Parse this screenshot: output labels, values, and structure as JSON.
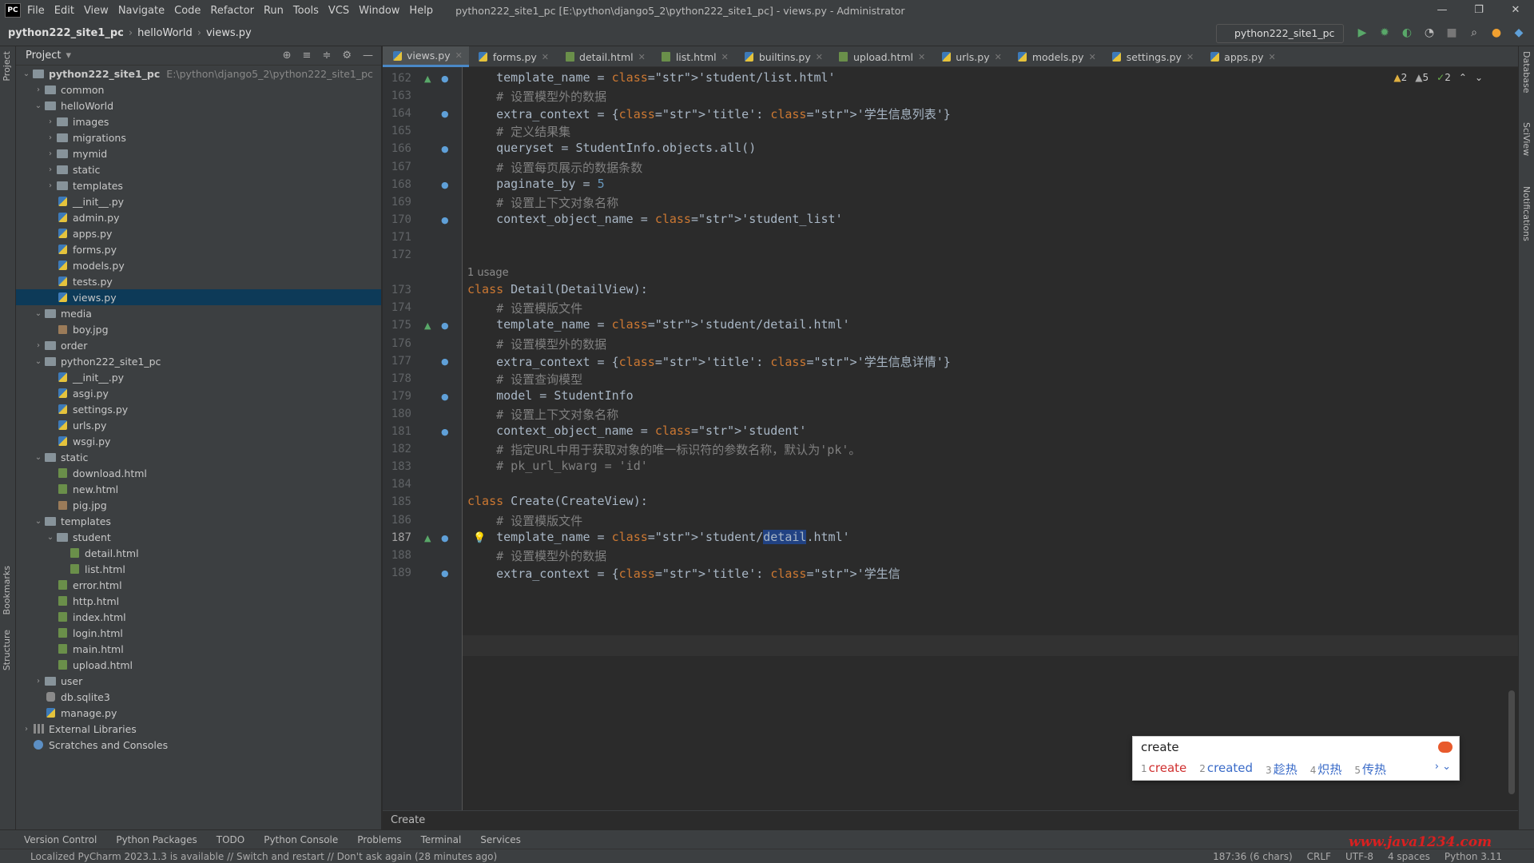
{
  "app": {
    "logo": "PC",
    "window_title": "python222_site1_pc [E:\\python\\django5_2\\python222_site1_pc] - views.py - Administrator",
    "menu": [
      "File",
      "Edit",
      "View",
      "Navigate",
      "Code",
      "Refactor",
      "Run",
      "Tools",
      "VCS",
      "Window",
      "Help"
    ],
    "window_controls": [
      "—",
      "❐",
      "✕"
    ]
  },
  "navbar": {
    "breadcrumb": [
      "python222_site1_pc",
      "helloWorld",
      "views.py"
    ],
    "run_config": "python222_site1_pc"
  },
  "side_strips": {
    "left": [
      "Project",
      "Bookmarks",
      "Structure"
    ],
    "right": [
      "Database",
      "SciView",
      "Notifications"
    ]
  },
  "project_panel": {
    "title": "Project",
    "root_path": "E:\\python\\django5_2\\python222_site1_pc",
    "tree": [
      {
        "label": "python222_site1_pc",
        "type": "folder",
        "open": true,
        "bold": true
      },
      {
        "label": "common",
        "type": "folder",
        "open": false
      },
      {
        "label": "helloWorld",
        "type": "folder",
        "open": true
      },
      {
        "label": "images",
        "type": "folder",
        "open": false
      },
      {
        "label": "migrations",
        "type": "folder",
        "open": false
      },
      {
        "label": "mymid",
        "type": "folder",
        "open": false
      },
      {
        "label": "static",
        "type": "folder",
        "open": false
      },
      {
        "label": "templates",
        "type": "folder",
        "open": false
      },
      {
        "label": "__init__.py",
        "type": "py"
      },
      {
        "label": "admin.py",
        "type": "py"
      },
      {
        "label": "apps.py",
        "type": "py"
      },
      {
        "label": "forms.py",
        "type": "py"
      },
      {
        "label": "models.py",
        "type": "py"
      },
      {
        "label": "tests.py",
        "type": "py"
      },
      {
        "label": "views.py",
        "type": "py",
        "selected": true
      },
      {
        "label": "media",
        "type": "folder",
        "open": true
      },
      {
        "label": "boy.jpg",
        "type": "img"
      },
      {
        "label": "order",
        "type": "folder",
        "open": false
      },
      {
        "label": "python222_site1_pc",
        "type": "folder",
        "open": true
      },
      {
        "label": "__init__.py",
        "type": "py"
      },
      {
        "label": "asgi.py",
        "type": "py"
      },
      {
        "label": "settings.py",
        "type": "py"
      },
      {
        "label": "urls.py",
        "type": "py"
      },
      {
        "label": "wsgi.py",
        "type": "py"
      },
      {
        "label": "static",
        "type": "folder",
        "open": true
      },
      {
        "label": "download.html",
        "type": "html"
      },
      {
        "label": "new.html",
        "type": "html"
      },
      {
        "label": "pig.jpg",
        "type": "img"
      },
      {
        "label": "templates",
        "type": "folder",
        "open": true
      },
      {
        "label": "student",
        "type": "folder",
        "open": true
      },
      {
        "label": "detail.html",
        "type": "html"
      },
      {
        "label": "list.html",
        "type": "html"
      },
      {
        "label": "error.html",
        "type": "html"
      },
      {
        "label": "http.html",
        "type": "html"
      },
      {
        "label": "index.html",
        "type": "html"
      },
      {
        "label": "login.html",
        "type": "html"
      },
      {
        "label": "main.html",
        "type": "html"
      },
      {
        "label": "upload.html",
        "type": "html"
      },
      {
        "label": "user",
        "type": "folder",
        "open": false
      },
      {
        "label": "db.sqlite3",
        "type": "db"
      },
      {
        "label": "manage.py",
        "type": "py"
      },
      {
        "label": "External Libraries",
        "type": "lib",
        "open": false
      },
      {
        "label": "Scratches and Consoles",
        "type": "scratch"
      }
    ]
  },
  "tabs": [
    {
      "label": "views.py",
      "type": "py",
      "active": true
    },
    {
      "label": "forms.py",
      "type": "py"
    },
    {
      "label": "detail.html",
      "type": "html"
    },
    {
      "label": "list.html",
      "type": "html"
    },
    {
      "label": "builtins.py",
      "type": "py"
    },
    {
      "label": "upload.html",
      "type": "html"
    },
    {
      "label": "urls.py",
      "type": "py"
    },
    {
      "label": "models.py",
      "type": "py"
    },
    {
      "label": "settings.py",
      "type": "py"
    },
    {
      "label": "apps.py",
      "type": "py"
    }
  ],
  "inspections": {
    "warn1": "2",
    "warn2": "5",
    "ok": "2"
  },
  "code": {
    "usage_hint": "1 usage",
    "lines": [
      {
        "n": "162",
        "text": "    template_name = 'student/list.html'"
      },
      {
        "n": "163",
        "text": "    # 设置模型外的数据"
      },
      {
        "n": "164",
        "text": "    extra_context = {'title': '学生信息列表'}"
      },
      {
        "n": "165",
        "text": "    # 定义结果集"
      },
      {
        "n": "166",
        "text": "    queryset = StudentInfo.objects.all()"
      },
      {
        "n": "167",
        "text": "    # 设置每页展示的数据条数"
      },
      {
        "n": "168",
        "text": "    paginate_by = 5"
      },
      {
        "n": "169",
        "text": "    # 设置上下文对象名称"
      },
      {
        "n": "170",
        "text": "    context_object_name = 'student_list'"
      },
      {
        "n": "171",
        "text": ""
      },
      {
        "n": "172",
        "text": ""
      },
      {
        "n": "173",
        "text": "class Detail(DetailView):"
      },
      {
        "n": "174",
        "text": "    # 设置模版文件"
      },
      {
        "n": "175",
        "text": "    template_name = 'student/detail.html'"
      },
      {
        "n": "176",
        "text": "    # 设置模型外的数据"
      },
      {
        "n": "177",
        "text": "    extra_context = {'title': '学生信息详情'}"
      },
      {
        "n": "178",
        "text": "    # 设置查询模型"
      },
      {
        "n": "179",
        "text": "    model = StudentInfo"
      },
      {
        "n": "180",
        "text": "    # 设置上下文对象名称"
      },
      {
        "n": "181",
        "text": "    context_object_name = 'student'"
      },
      {
        "n": "182",
        "text": "    # 指定URL中用于获取对象的唯一标识符的参数名称，默认为'pk'。"
      },
      {
        "n": "183",
        "text": "    # pk_url_kwarg = 'id'"
      },
      {
        "n": "184",
        "text": ""
      },
      {
        "n": "185",
        "text": "class Create(CreateView):"
      },
      {
        "n": "186",
        "text": "    # 设置模版文件"
      },
      {
        "n": "187",
        "text": "    template_name = 'student/detail.html'"
      },
      {
        "n": "188",
        "text": "    # 设置模型外的数据"
      },
      {
        "n": "189",
        "text": "    extra_context = {'title': '学生信"
      }
    ]
  },
  "ime": {
    "input": "create",
    "candidates": [
      {
        "num": "1",
        "text": "create"
      },
      {
        "num": "2",
        "text": "created"
      },
      {
        "num": "3",
        "text": "趁热"
      },
      {
        "num": "4",
        "text": "炽热"
      },
      {
        "num": "5",
        "text": "传热"
      }
    ],
    "more": "› ⌄"
  },
  "editor_breadcrumb": "Create",
  "toolwindows": [
    "Version Control",
    "Python Packages",
    "TODO",
    "Python Console",
    "Problems",
    "Terminal",
    "Services"
  ],
  "status": {
    "message": "Localized PyCharm 2023.1.3 is available // Switch and restart // Don't ask again (28 minutes ago)",
    "position": "187:36 (6 chars)",
    "line_sep": "CRLF",
    "encoding": "UTF-8",
    "indent": "4 spaces",
    "interpreter": "Python 3.11"
  },
  "watermark": "www.java1234.com"
}
